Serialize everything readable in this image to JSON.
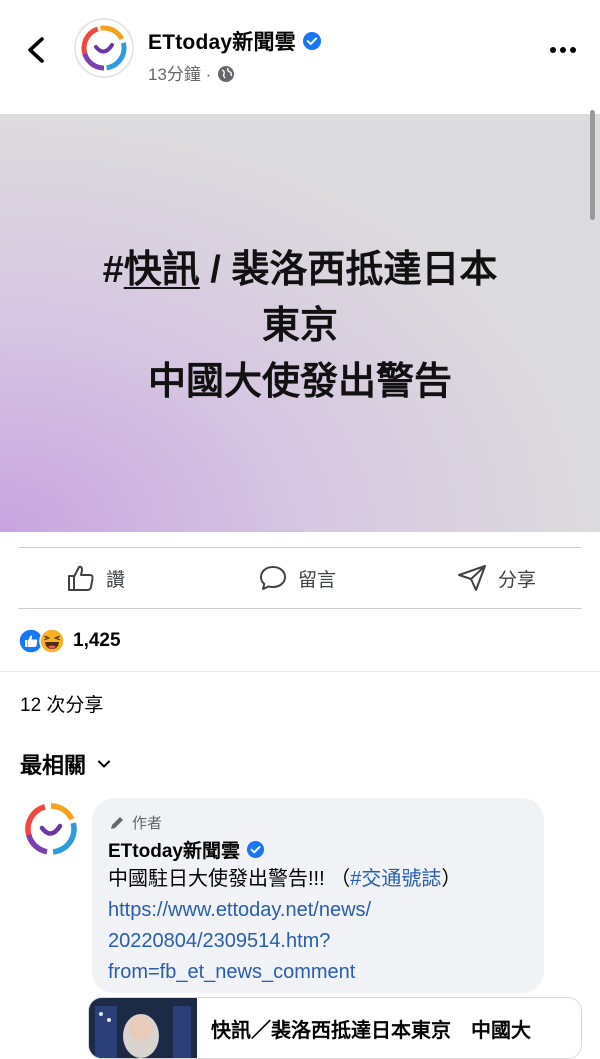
{
  "header": {
    "page_name": "ETtoday新聞雲",
    "time_ago": "13分鐘",
    "separator": "·",
    "icons": [
      "back-arrow-icon",
      "verified-badge-icon",
      "globe-icon",
      "more-dots-icon"
    ]
  },
  "post": {
    "image_text": {
      "hash": "#",
      "hashtag_word": "快訊",
      "line1_rest": " / 裴洛西抵達日本",
      "line2": "東京",
      "line3": "中國大使發出警告"
    },
    "gradient_colors": [
      "#dcdbdd",
      "#c8a4e0"
    ]
  },
  "actions": {
    "like_label": "讚",
    "comment_label": "留言",
    "share_label": "分享"
  },
  "reactions": {
    "count": "1,425",
    "types": [
      "like",
      "haha"
    ],
    "like_color": "#1877f2",
    "haha_color": "#f7b125"
  },
  "shares_text": "12 次分享",
  "sort_label": "最相關",
  "comments": [
    {
      "author_badge": "作者",
      "name": "ETtoday新聞雲",
      "text": "中國駐日大使發出警告!!! （",
      "hashtag": "#交通號誌",
      "text_end": "）",
      "link_line1": "https://www.ettoday.net/news/",
      "link_line2": "20220804/2309514.htm?",
      "link_line3": "from=fb_et_news_comment"
    }
  ],
  "link_preview": {
    "title": "快訊／裴洛西抵達日本東京　中國大"
  },
  "accent_color": "#1877f2"
}
